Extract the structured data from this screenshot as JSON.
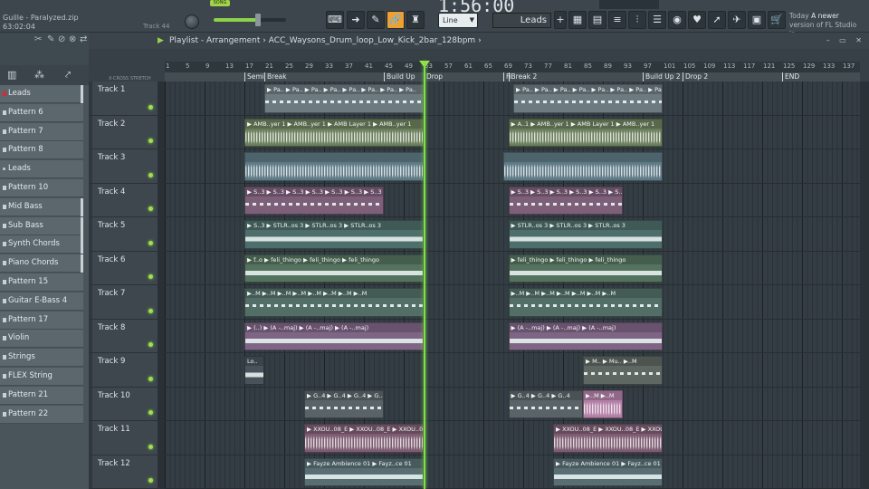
{
  "toolbar": {
    "project_title": "Guille - Paralyzed.zip",
    "elapsed": "63:02:04",
    "track_label": "Track 44",
    "song_mode": "SONG",
    "time_display": "1:56:00",
    "snap_mode": "Line",
    "pattern_selector": "Leads",
    "news_title": "Today",
    "news_line1": "A newer",
    "news_line2": "version of FL Studio is..."
  },
  "browser": {
    "tabs": [
      "piano-icon",
      "plugin-icon",
      "cable-icon"
    ],
    "patterns": [
      {
        "label": "Leads",
        "color": "red"
      },
      {
        "label": "Pattern 6",
        "color": "grey"
      },
      {
        "label": "Pattern 7",
        "color": "grey"
      },
      {
        "label": "Pattern 8",
        "color": "grey"
      },
      {
        "label": "Leads",
        "color": "dot"
      },
      {
        "label": "Pattern 10",
        "color": "grey"
      },
      {
        "label": "Mid Bass",
        "color": "grey"
      },
      {
        "label": "Sub Bass",
        "color": "grey"
      },
      {
        "label": "Synth Chords",
        "color": "grey"
      },
      {
        "label": "Piano Chords",
        "color": "grey"
      },
      {
        "label": "Pattern 15",
        "color": "grey"
      },
      {
        "label": "Guitar E-Bass 4",
        "color": "grey"
      },
      {
        "label": "Pattern 17",
        "color": "grey"
      },
      {
        "label": "Violin",
        "color": "grey"
      },
      {
        "label": "Strings",
        "color": "grey"
      },
      {
        "label": "FLEX String",
        "color": "grey"
      },
      {
        "label": "Pattern 21",
        "color": "grey"
      },
      {
        "label": "Pattern 22",
        "color": "grey"
      }
    ]
  },
  "playlist": {
    "title": "Playlist - Arrangement",
    "separator": "›",
    "clip_source": "ACC_Waysons_Drum_loop_Low_Kick_2bar_128bpm",
    "snap_labels": "X-CROSS  STRETCH",
    "ruler": [
      1,
      5,
      9,
      13,
      17,
      21,
      25,
      29,
      33,
      37,
      41,
      45,
      49,
      53,
      57,
      61,
      65,
      69,
      73,
      77,
      81,
      85,
      89,
      93,
      97,
      101,
      105,
      109,
      113,
      117,
      121,
      125,
      129,
      133,
      137
    ],
    "markers": [
      {
        "label": "Semi",
        "bar": 17
      },
      {
        "label": "Break",
        "bar": 21
      },
      {
        "label": "Build Up",
        "bar": 45
      },
      {
        "label": "Drop",
        "bar": 53
      },
      {
        "label": "Fi",
        "bar": 69
      },
      {
        "label": "Break 2",
        "bar": 70
      },
      {
        "label": "Build Up 2",
        "bar": 97
      },
      {
        "label": "Drop 2",
        "bar": 105
      },
      {
        "label": "END",
        "bar": 125
      }
    ],
    "playhead_bar": 53,
    "tracks": [
      {
        "name": "Track 1",
        "clips": [
          {
            "start": 21,
            "end": 53,
            "label": "▶ Pa.. ▶ Pa.. ▶ Pa.. ▶ Pa.. ▶ Pa.. ▶ Pa.. ▶ Pa.. ▶ Pa..",
            "color": "#6d7a80",
            "style": "midi"
          },
          {
            "start": 71,
            "end": 101,
            "label": "▶ Pa.. ▶ Pa.. ▶ Pa.. ▶ Pa.. ▶ Pa.. ▶ Pa.. ▶ Pa.. ▶ Pa..",
            "color": "#6d7a80",
            "style": "midi"
          }
        ]
      },
      {
        "name": "Track 2",
        "clips": [
          {
            "start": 17,
            "end": 53,
            "label": "▶ AMB..yer 1 ▶ AMB..yer 1 ▶ AMB Layer 1 ▶ AMB..yer 1",
            "color": "#6b7f5c",
            "style": "wave"
          },
          {
            "start": 70,
            "end": 101,
            "label": "▶ A..1 ▶ AMB..yer 1 ▶ AMB Layer 1 ▶ AMB..yer 1",
            "color": "#6b7f5c",
            "style": "wave"
          }
        ]
      },
      {
        "name": "Track 3",
        "clips": [
          {
            "start": 17,
            "end": 53,
            "label": "",
            "color": "#5e7a86",
            "style": "wave"
          },
          {
            "start": 69,
            "end": 101,
            "label": "",
            "color": "#5e7a86",
            "style": "wave"
          }
        ]
      },
      {
        "name": "Track 4",
        "clips": [
          {
            "start": 17,
            "end": 45,
            "label": "▶ S..3 ▶ S..3 ▶ S..3 ▶ S..3 ▶ S..3 ▶ S..3 ▶ S..3",
            "color": "#7d5f7a",
            "style": "midi"
          },
          {
            "start": 70,
            "end": 93,
            "label": "▶ S..3 ▶ S..3 ▶ S..3 ▶ S..3 ▶ S..3 ▶ S..3",
            "color": "#7d5f7a",
            "style": "midi"
          }
        ]
      },
      {
        "name": "Track 5",
        "clips": [
          {
            "start": 17,
            "end": 53,
            "label": "▶ S..3 ▶ STLR..os 3 ▶ STLR..os 3 ▶ STLR..os 3",
            "color": "#4d6e6a",
            "style": "band"
          },
          {
            "start": 70,
            "end": 101,
            "label": "▶ STLR..os 3 ▶ STLR..os 3 ▶ STLR..os 3",
            "color": "#4d6e6a",
            "style": "band"
          }
        ]
      },
      {
        "name": "Track 6",
        "clips": [
          {
            "start": 17,
            "end": 53,
            "label": "▶ f..o ▶ feli_thingo ▶ feli_thingo ▶ feli_thingo",
            "color": "#55725e",
            "style": "band"
          },
          {
            "start": 70,
            "end": 101,
            "label": "▶ feli_thingo ▶ feli_thingo ▶ feli_thingo",
            "color": "#55725e",
            "style": "band"
          }
        ]
      },
      {
        "name": "Track 7",
        "clips": [
          {
            "start": 17,
            "end": 53,
            "label": "▶..M ▶..M ▶..M ▶..M ▶..M ▶..M ▶..M ▶..M",
            "color": "#536e67",
            "style": "midi"
          },
          {
            "start": 70,
            "end": 101,
            "label": "▶..M ▶..M ▶..M ▶..M ▶..M ▶..M ▶..M",
            "color": "#536e67",
            "style": "midi"
          }
        ]
      },
      {
        "name": "Track 8",
        "clips": [
          {
            "start": 17,
            "end": 53,
            "label": "▶ (..) ▶ (A -..maj) ▶ (A -..maj) ▶ (A -..maj)",
            "color": "#7f6585",
            "style": "band"
          },
          {
            "start": 70,
            "end": 101,
            "label": "▶ (A -..maj) ▶ (A -..maj) ▶ (A -..maj)",
            "color": "#7f6585",
            "style": "band"
          }
        ]
      },
      {
        "name": "Track 9",
        "clips": [
          {
            "start": 17,
            "end": 21,
            "label": "Lo..",
            "color": "#47525a",
            "style": "band"
          },
          {
            "start": 85,
            "end": 101,
            "label": "▶ M.. ▶ Mu.. ▶..M",
            "color": "#5f6762",
            "style": "midi"
          }
        ]
      },
      {
        "name": "Track 10",
        "clips": [
          {
            "start": 29,
            "end": 45,
            "label": "▶ G..4 ▶ G..4 ▶ G..4 ▶ G..4",
            "color": "#5a6468",
            "style": "midi"
          },
          {
            "start": 70,
            "end": 85,
            "label": "▶ G..4 ▶ G..4 ▶ G..4",
            "color": "#5a6468",
            "style": "midi"
          },
          {
            "start": 85,
            "end": 93,
            "label": "▶..M ▶..M",
            "color": "#b37fa6",
            "style": "wave"
          }
        ]
      },
      {
        "name": "Track 11",
        "clips": [
          {
            "start": 29,
            "end": 53,
            "label": "▶ XXOU..08_E ▶ XXOU..08_E ▶ XXOU..08_E",
            "color": "#7d5c72",
            "style": "wave"
          },
          {
            "start": 79,
            "end": 101,
            "label": "▶ XXOU..08_E ▶ XXOU..08_E ▶ XXOU..08_E",
            "color": "#7d5c72",
            "style": "wave"
          }
        ]
      },
      {
        "name": "Track 12",
        "clips": [
          {
            "start": 29,
            "end": 53,
            "label": "▶ Fayze Ambience 01 ▶ Fayz..ce 01",
            "color": "#586e72",
            "style": "band"
          },
          {
            "start": 79,
            "end": 101,
            "label": "▶ Fayze Ambience 01 ▶ Fayz..ce 01",
            "color": "#586e72",
            "style": "band"
          }
        ]
      }
    ]
  }
}
